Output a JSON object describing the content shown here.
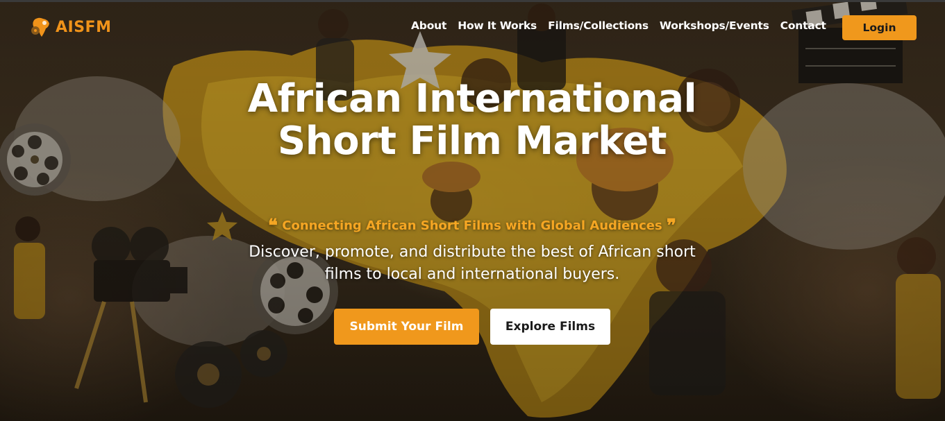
{
  "navbar": {
    "brand": "AISFM",
    "links": [
      "About",
      "How It Works",
      "Films/Collections",
      "Workshops/Events",
      "Contact"
    ],
    "login_label": "Login"
  },
  "hero": {
    "title": "African International Short Film Market",
    "tagline": "Connecting African Short Films with Global Audiences",
    "description": "Discover, promote, and distribute the best of African short films to local and international buyers.",
    "submit_label": "Submit Your Film",
    "explore_label": "Explore Films"
  },
  "colors": {
    "accent": "#f0981c",
    "tagline": "#f5a623",
    "text": "#ffffff"
  },
  "icons": {
    "logo": "african-map-film-reel-icon",
    "open_quote": "quote-left-icon",
    "close_quote": "quote-right-icon"
  }
}
